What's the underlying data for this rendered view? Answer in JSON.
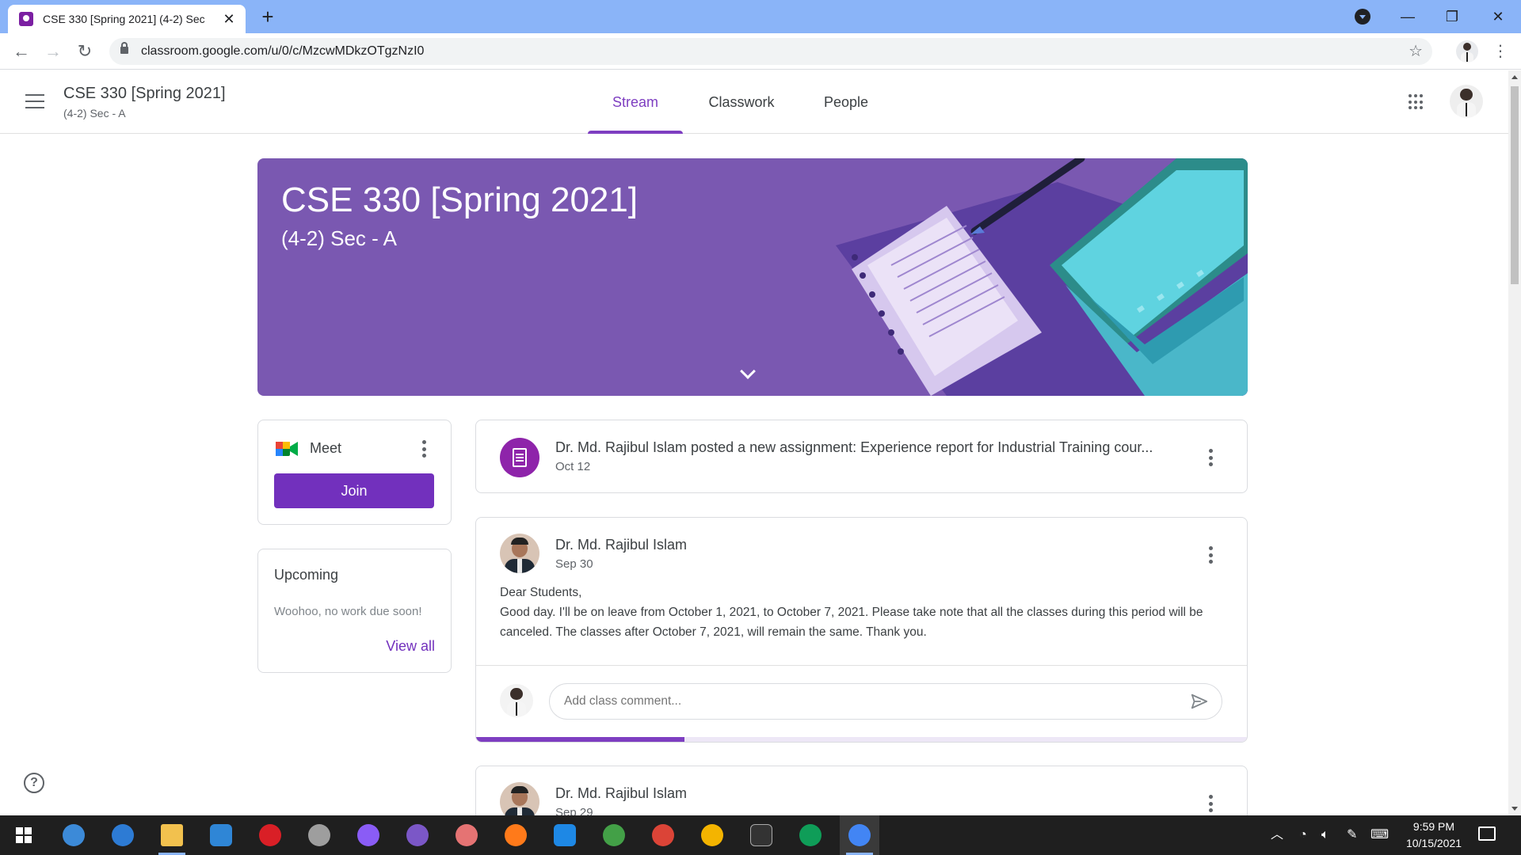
{
  "browser": {
    "tab_title": "CSE 330 [Spring 2021] (4-2) Sec",
    "url": "classroom.google.com/u/0/c/MzcwMDkzOTgzNzI0"
  },
  "header": {
    "course_title": "CSE 330 [Spring 2021]",
    "course_section": "(4-2) Sec - A",
    "tabs": [
      {
        "label": "Stream",
        "active": true
      },
      {
        "label": "Classwork",
        "active": false
      },
      {
        "label": "People",
        "active": false
      }
    ]
  },
  "banner": {
    "title": "CSE 330 [Spring 2021]",
    "subtitle": "(4-2) Sec - A",
    "color": "#7a58b1"
  },
  "meet": {
    "label": "Meet",
    "join_label": "Join"
  },
  "upcoming": {
    "title": "Upcoming",
    "empty_text": "Woohoo, no work due soon!",
    "view_all": "View all"
  },
  "stream": {
    "assignment": {
      "text": "Dr. Md. Rajibul Islam posted a new assignment: Experience report for Industrial Training cour...",
      "date": "Oct 12"
    },
    "posts": [
      {
        "author": "Dr. Md. Rajibul Islam",
        "date": "Sep 30",
        "greeting": "Dear Students,",
        "body": "Good day. I'll be on leave from October 1, 2021, to October 7, 2021. Please take note that all the classes during this period will be canceled. The classes after October 7, 2021, will remain the same. Thank you.",
        "comment_placeholder": "Add class comment...",
        "progress": 0.27
      },
      {
        "author": "Dr. Md. Rajibul Islam",
        "date": "Sep 29"
      }
    ]
  },
  "taskbar": {
    "time": "9:59 PM",
    "date": "10/15/2021"
  },
  "colors": {
    "accent": "#7230bd",
    "tab_accent": "#7e3ec1",
    "tabstrip": "#8ab4f8"
  }
}
